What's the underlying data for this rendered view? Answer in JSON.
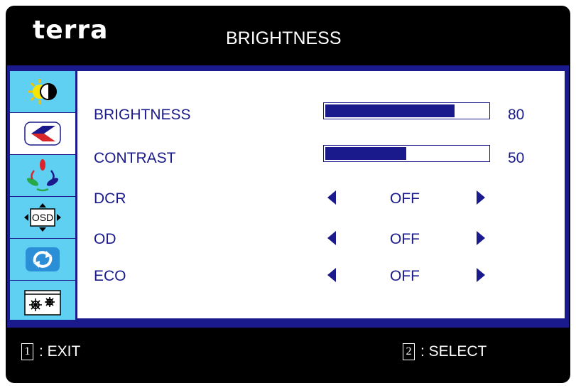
{
  "header": {
    "brand": "terra",
    "title": "BRIGHTNESS"
  },
  "sidebar": {
    "items": [
      {
        "name": "brightness-menu",
        "icon": "sun-moon-icon",
        "active": false
      },
      {
        "name": "image-menu",
        "icon": "image-setup-icon",
        "active": true
      },
      {
        "name": "color-menu",
        "icon": "rgb-color-icon",
        "active": false
      },
      {
        "name": "osd-menu",
        "icon": "osd-settings-icon",
        "active": false
      },
      {
        "name": "reset-menu",
        "icon": "reset-arrows-icon",
        "active": false
      },
      {
        "name": "misc-menu",
        "icon": "misc-settings-icon",
        "active": false
      }
    ]
  },
  "settings": {
    "brightness": {
      "label": "BRIGHTNESS",
      "value": "80",
      "level": 80
    },
    "contrast": {
      "label": "CONTRAST",
      "value": "50",
      "level": 50
    },
    "dcr": {
      "label": "DCR",
      "value": "OFF"
    },
    "od": {
      "label": "OD",
      "value": "OFF"
    },
    "eco": {
      "label": "ECO",
      "value": "OFF"
    }
  },
  "footer": {
    "exit_key": "1",
    "exit_label": ": EXIT",
    "select_key": "2",
    "select_label": ": SELECT"
  },
  "colors": {
    "navy": "#1a1a8c",
    "sidebar": "#5fd0f2",
    "frame": "#000000"
  }
}
